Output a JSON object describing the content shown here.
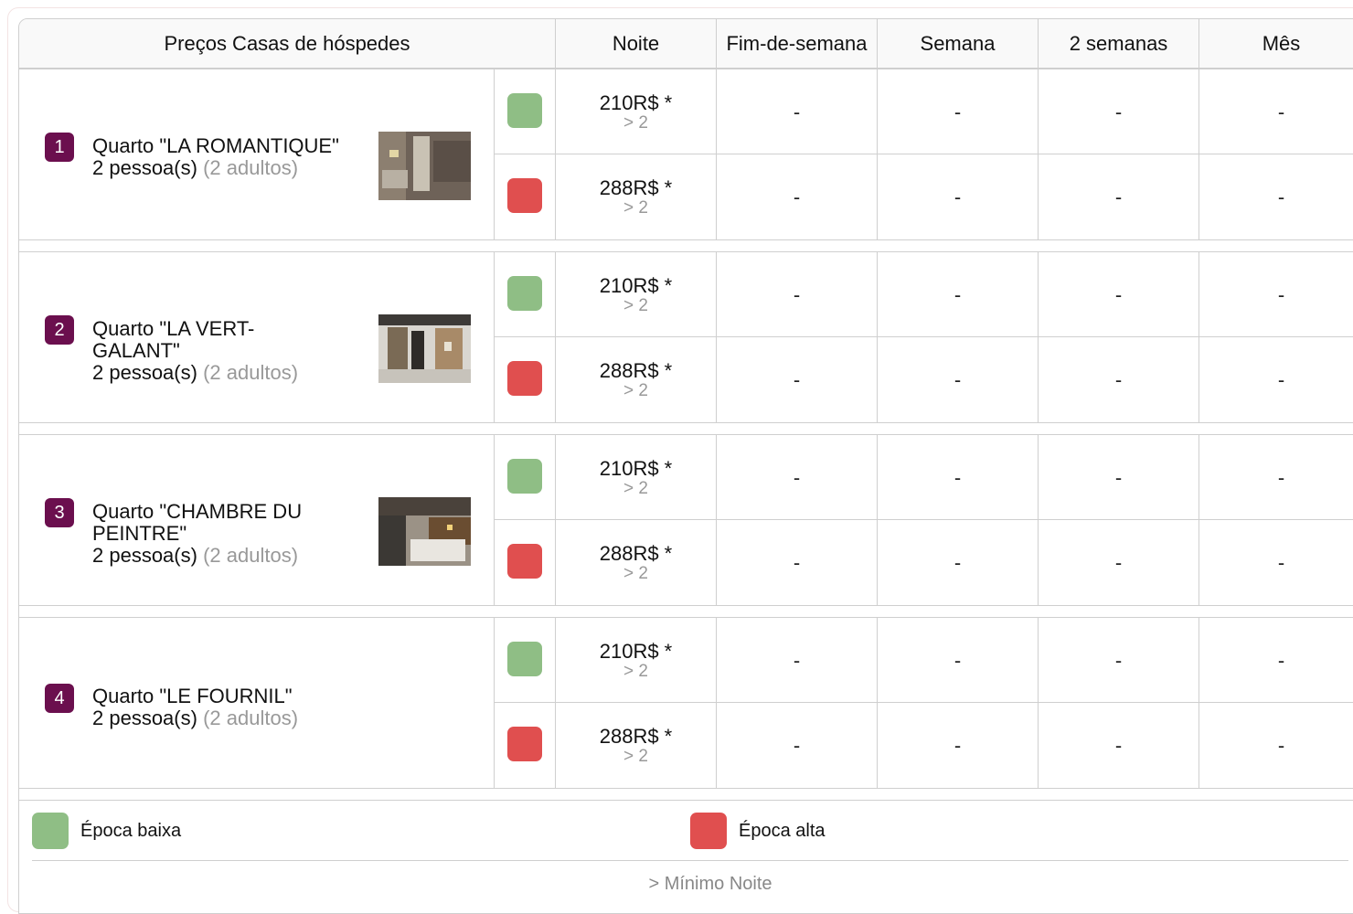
{
  "header": {
    "title": "Preços Casas de hóspedes",
    "col_night": "Noite",
    "col_weekend": "Fim-de-semana",
    "col_week": "Semana",
    "col_two_weeks": "2 semanas",
    "col_month": "Mês"
  },
  "rooms": [
    {
      "number": "1",
      "name": "Quarto \"LA ROMANTIQUE\"",
      "guests": "2 pessoa(s)",
      "adults": "(2 adultos)",
      "has_photo": true,
      "low": {
        "price": "210R$ *",
        "min": "> 2",
        "weekend": "-",
        "week": "-",
        "two_weeks": "-",
        "month": "-"
      },
      "high": {
        "price": "288R$ *",
        "min": "> 2",
        "weekend": "-",
        "week": "-",
        "two_weeks": "-",
        "month": "-"
      }
    },
    {
      "number": "2",
      "name": "Quarto \"LA VERT-GALANT\"",
      "guests": "2 pessoa(s)",
      "adults": "(2 adultos)",
      "has_photo": true,
      "low": {
        "price": "210R$ *",
        "min": "> 2",
        "weekend": "-",
        "week": "-",
        "two_weeks": "-",
        "month": "-"
      },
      "high": {
        "price": "288R$ *",
        "min": "> 2",
        "weekend": "-",
        "week": "-",
        "two_weeks": "-",
        "month": "-"
      }
    },
    {
      "number": "3",
      "name": "Quarto \"CHAMBRE DU PEINTRE\"",
      "guests": "2 pessoa(s)",
      "adults": "(2 adultos)",
      "has_photo": true,
      "low": {
        "price": "210R$ *",
        "min": "> 2",
        "weekend": "-",
        "week": "-",
        "two_weeks": "-",
        "month": "-"
      },
      "high": {
        "price": "288R$ *",
        "min": "> 2",
        "weekend": "-",
        "week": "-",
        "two_weeks": "-",
        "month": "-"
      }
    },
    {
      "number": "4",
      "name": "Quarto \"LE FOURNIL\"",
      "guests": "2 pessoa(s)",
      "adults": "(2 adultos)",
      "has_photo": false,
      "low": {
        "price": "210R$ *",
        "min": "> 2",
        "weekend": "-",
        "week": "-",
        "two_weeks": "-",
        "month": "-"
      },
      "high": {
        "price": "288R$ *",
        "min": "> 2",
        "weekend": "-",
        "week": "-",
        "two_weeks": "-",
        "month": "-"
      }
    }
  ],
  "legend": {
    "low_season": "Época baixa",
    "high_season": "Época alta",
    "low_color": "#8fbe85",
    "high_color": "#e04f4f"
  },
  "footnote": "> Mínimo Noite",
  "colors": {
    "badge": "#6b0f4e",
    "border": "#cfcfcf",
    "muted": "#999999"
  }
}
